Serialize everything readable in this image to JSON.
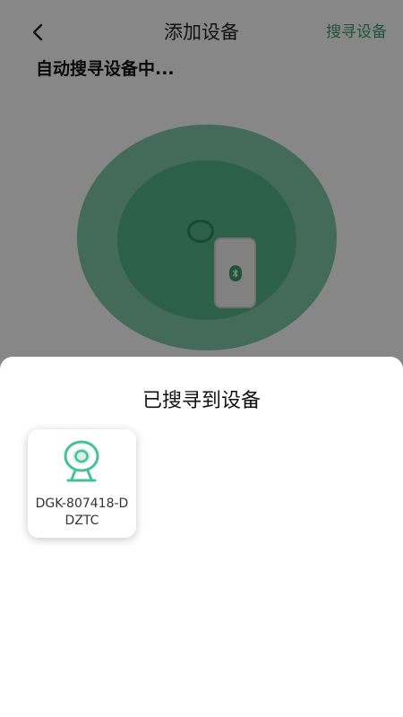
{
  "header": {
    "title": "添加设备",
    "search_label": "搜寻设备",
    "back_icon": "chevron-left-icon"
  },
  "status_text": "自动搜寻设备中...",
  "radar": {
    "outer_color": "#80c9a8",
    "inner_color": "#56b689",
    "phone_icon": "phone-icon",
    "bluetooth_icon": "bluetooth-icon"
  },
  "sheet": {
    "title": "已搜寻到设备",
    "devices": [
      {
        "name": "DGK-807418-DDZTC",
        "icon": "camera-icon"
      }
    ]
  },
  "colors": {
    "accent": "#3a9d72",
    "icon_green": "#43c197"
  }
}
